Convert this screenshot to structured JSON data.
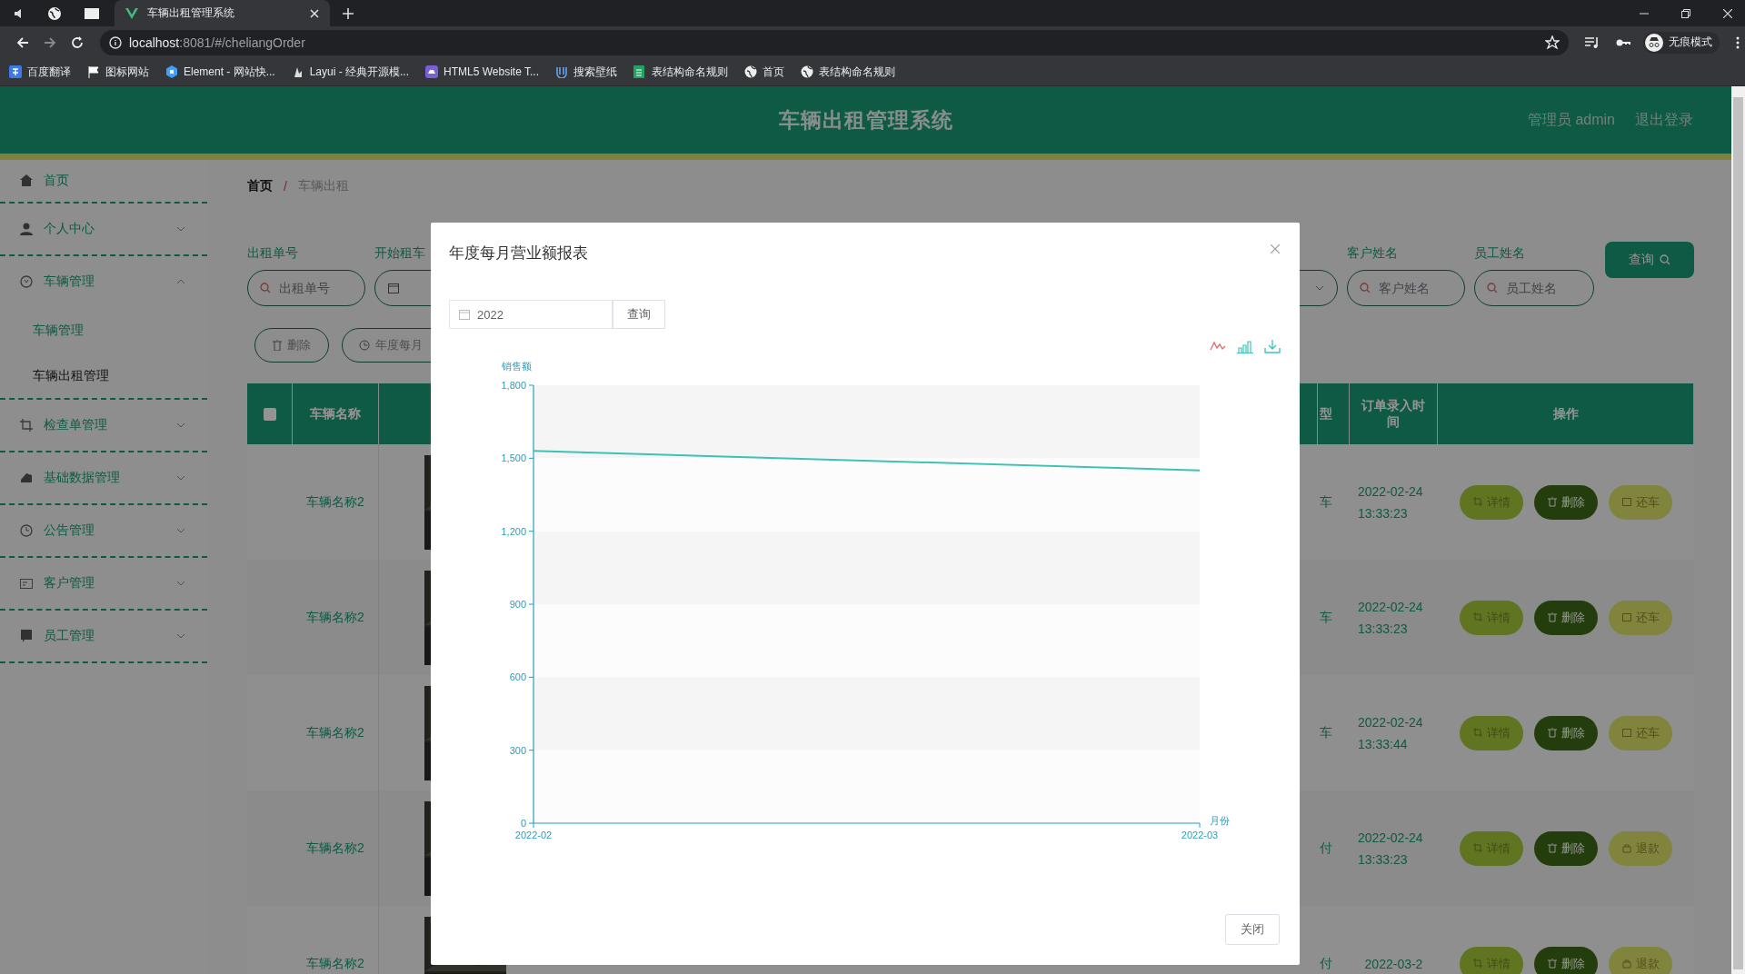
{
  "browser": {
    "tab_title": "车辆出租管理系统",
    "url_host": "localhost",
    "url_rest": ":8081/#/cheliangOrder",
    "profile": "无痕模式",
    "bookmarks": [
      {
        "label": "百度翻译"
      },
      {
        "label": "图标网站"
      },
      {
        "label": "Element - 网站快..."
      },
      {
        "label": "Layui - 经典开源模..."
      },
      {
        "label": "HTML5 Website T..."
      },
      {
        "label": "搜索壁纸"
      },
      {
        "label": "表结构命名规则"
      },
      {
        "label": "首页"
      },
      {
        "label": "表结构命名规则"
      }
    ]
  },
  "header": {
    "title": "车辆出租管理系统",
    "user": "管理员 admin",
    "logout": "退出登录"
  },
  "sidebar": {
    "items": [
      {
        "label": "首页",
        "kind": "link"
      },
      {
        "label": "个人中心",
        "kind": "menu",
        "expanded": false
      },
      {
        "label": "车辆管理",
        "kind": "menu",
        "expanded": true,
        "children": [
          {
            "label": "车辆管理",
            "selected": false
          },
          {
            "label": "车辆出租管理",
            "selected": true
          }
        ]
      },
      {
        "label": "检查单管理",
        "kind": "menu",
        "expanded": false
      },
      {
        "label": "基础数据管理",
        "kind": "menu",
        "expanded": false
      },
      {
        "label": "公告管理",
        "kind": "menu",
        "expanded": false
      },
      {
        "label": "客户管理",
        "kind": "menu",
        "expanded": false
      },
      {
        "label": "员工管理",
        "kind": "menu",
        "expanded": false
      }
    ]
  },
  "breadcrumb": {
    "items": [
      "首页",
      "车辆出租"
    ],
    "separator": "/"
  },
  "filters": [
    {
      "kind": "text",
      "label": "出租单号",
      "placeholder": "出租单号"
    },
    {
      "kind": "date",
      "label": "开始租车"
    },
    {
      "kind": "select"
    },
    {
      "kind": "text",
      "label": "客户姓名",
      "placeholder": "客户姓名"
    },
    {
      "kind": "text",
      "label": "员工姓名",
      "placeholder": "员工姓名"
    }
  ],
  "search_button": "查询",
  "actions": [
    {
      "kind": "delete",
      "label": "删除"
    },
    {
      "kind": "chart",
      "label": "年度每月"
    }
  ],
  "table": {
    "select_all_checked": false,
    "columns": {
      "name": "车辆名称",
      "column_type": "型",
      "entered": "订单录入时间",
      "operations": "操作"
    },
    "rows": [
      {
        "name": "车辆名称2",
        "column_type": "车",
        "entered": "2022-02-24 13:33:23",
        "actions": [
          {
            "kind": "detail",
            "label": "详情"
          },
          {
            "kind": "delete",
            "label": "删除"
          },
          {
            "kind": "return",
            "label": "还车"
          }
        ]
      },
      {
        "name": "车辆名称2",
        "column_type": "车",
        "entered": "2022-02-24 13:33:23",
        "actions": [
          {
            "kind": "detail",
            "label": "详情"
          },
          {
            "kind": "delete",
            "label": "删除"
          },
          {
            "kind": "return",
            "label": "还车"
          }
        ]
      },
      {
        "name": "车辆名称2",
        "column_type": "车",
        "entered": "2022-02-24 13:33:44",
        "actions": [
          {
            "kind": "detail",
            "label": "详情"
          },
          {
            "kind": "delete",
            "label": "删除"
          },
          {
            "kind": "return",
            "label": "还车"
          }
        ]
      },
      {
        "name": "车辆名称2",
        "column_type": "付",
        "entered": "2022-02-24 13:33:23",
        "actions": [
          {
            "kind": "detail",
            "label": "详情"
          },
          {
            "kind": "delete",
            "label": "删除"
          },
          {
            "kind": "refund",
            "label": "退款"
          }
        ]
      },
      {
        "name": "车辆名称2",
        "column_type": "付",
        "entered": "2022-03-2",
        "actions": [
          {
            "kind": "detail",
            "label": "详情"
          },
          {
            "kind": "delete",
            "label": "删除"
          },
          {
            "kind": "refund",
            "label": "退款"
          }
        ]
      }
    ]
  },
  "modal": {
    "title": "年度每月营业额报表",
    "year": "2022",
    "query_button": "查询",
    "close_button": "关闭",
    "chart_data": {
      "type": "line",
      "xlabel": "月份",
      "ylabel": "销售额",
      "categories": [
        "2022-02",
        "2022-03"
      ],
      "series": [
        {
          "color": "#3cc3b4",
          "values": [
            1530,
            1450
          ]
        }
      ],
      "ylim": [
        0,
        1800
      ],
      "yticks": [
        {
          "value": 0,
          "label": "0"
        },
        {
          "value": 300,
          "label": "300"
        },
        {
          "value": 600,
          "label": "600"
        },
        {
          "value": 900,
          "label": "900"
        },
        {
          "value": 1200,
          "label": "1,200"
        },
        {
          "value": 1500,
          "label": "1,500"
        },
        {
          "value": 1800,
          "label": "1,800"
        }
      ]
    }
  }
}
